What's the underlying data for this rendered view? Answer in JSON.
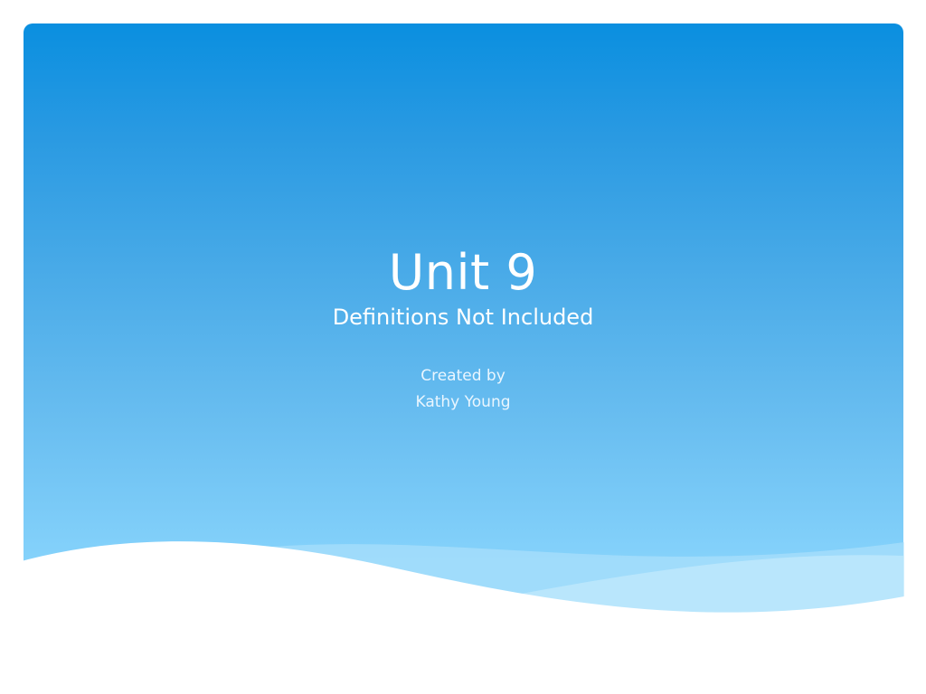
{
  "slide": {
    "title": "Unit 9",
    "subtitle": "Definitions Not Included",
    "credits": {
      "line1": "Created by",
      "line2": "Kathy Young"
    }
  },
  "colors": {
    "background_top": "#0a8fe0",
    "background_bottom": "#8ad4fc",
    "text": "#ffffff"
  }
}
